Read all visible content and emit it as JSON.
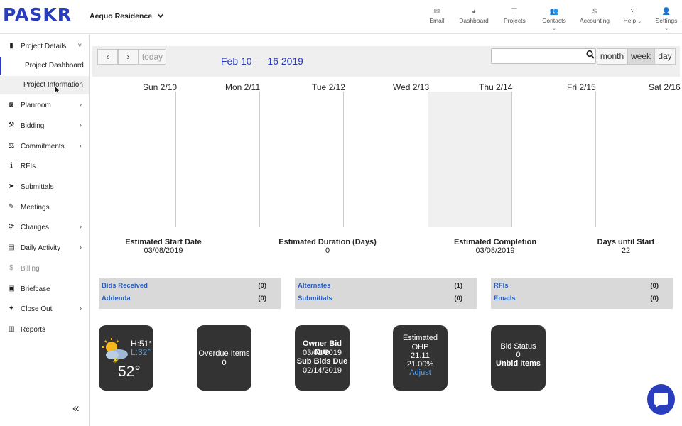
{
  "header": {
    "logo": "PASKR",
    "project": "Aequo Residence",
    "nav": [
      {
        "label": "Email",
        "icon": "envelope-icon",
        "glyph": "✉",
        "caret": ""
      },
      {
        "label": "Dashboard",
        "icon": "dashboard-icon",
        "glyph": "◕",
        "caret": ""
      },
      {
        "label": "Projects",
        "icon": "list-icon",
        "glyph": "☰",
        "caret": ""
      },
      {
        "label": "Contacts",
        "icon": "users-icon",
        "glyph": "👥",
        "caret": "⌄"
      },
      {
        "label": "Accounting",
        "icon": "dollar-icon",
        "glyph": "$",
        "caret": ""
      },
      {
        "label": "Help",
        "icon": "question-icon",
        "glyph": "?",
        "caret": "⌄"
      },
      {
        "label": "Settings",
        "icon": "user-icon",
        "glyph": "👤",
        "caret": "⌄"
      }
    ]
  },
  "sidebar": {
    "items": [
      {
        "label": "Project Details",
        "icon": "building-icon",
        "glyph": "▮",
        "chevron": "˅"
      },
      {
        "label": "Planroom",
        "icon": "camera-icon",
        "glyph": "◙",
        "chevron": "›"
      },
      {
        "label": "Bidding",
        "icon": "gavel-icon",
        "glyph": "⚒",
        "chevron": "›"
      },
      {
        "label": "Commitments",
        "icon": "scale-icon",
        "glyph": "⚖",
        "chevron": "›"
      },
      {
        "label": "RFIs",
        "icon": "info-icon",
        "glyph": "ℹ",
        "chevron": ""
      },
      {
        "label": "Submittals",
        "icon": "paper-plane-icon",
        "glyph": "➤",
        "chevron": ""
      },
      {
        "label": "Meetings",
        "icon": "edit-icon",
        "glyph": "✎",
        "chevron": ""
      },
      {
        "label": "Changes",
        "icon": "refresh-icon",
        "glyph": "⟳",
        "chevron": "›"
      },
      {
        "label": "Daily Activity",
        "icon": "book-icon",
        "glyph": "▤",
        "chevron": "›"
      },
      {
        "label": "Billing",
        "icon": "dollar-icon",
        "glyph": "$",
        "chevron": ""
      },
      {
        "label": "Briefcase",
        "icon": "briefcase-icon",
        "glyph": "▣",
        "chevron": ""
      },
      {
        "label": "Close Out",
        "icon": "pin-icon",
        "glyph": "✦",
        "chevron": "›"
      },
      {
        "label": "Reports",
        "icon": "chart-icon",
        "glyph": "▥",
        "chevron": ""
      }
    ],
    "subitems": [
      {
        "label": "Project Dashboard"
      },
      {
        "label": "Project Information"
      }
    ],
    "collapse": "«"
  },
  "calendar": {
    "today": "today",
    "range": "Feb 10 — 16 2019",
    "views": [
      "month",
      "week",
      "day"
    ],
    "days": [
      "Sun 2/10",
      "Mon 2/11",
      "Tue 2/12",
      "Wed 2/13",
      "Thu 2/14",
      "Fri 2/15",
      "Sat 2/16"
    ]
  },
  "stats": [
    {
      "label": "Estimated Start Date",
      "value": "03/08/2019"
    },
    {
      "label": "Estimated Duration (Days)",
      "value": "0"
    },
    {
      "label": "Estimated Completion",
      "value": "03/08/2019"
    },
    {
      "label": "Days until Start",
      "value": "22"
    }
  ],
  "panels": [
    {
      "rows": [
        {
          "label": "Bids Received",
          "count": "(0)"
        },
        {
          "label": "Addenda",
          "count": "(0)"
        }
      ]
    },
    {
      "rows": [
        {
          "label": "Alternates",
          "count": "(1)"
        },
        {
          "label": "Submittals",
          "count": "(0)"
        }
      ]
    },
    {
      "rows": [
        {
          "label": "RFIs",
          "count": "(0)"
        },
        {
          "label": "Emails",
          "count": "(0)"
        }
      ]
    }
  ],
  "tiles": {
    "weather": {
      "high": "H:51°",
      "low": "L:32°",
      "temp": "52°"
    },
    "overdue": {
      "label": "Overdue Items",
      "value": "0"
    },
    "bid": {
      "owner_label": "Owner Bid Due",
      "owner_date": "03/01/2019",
      "sub_label": "Sub Bids Due",
      "sub_date": "02/14/2019"
    },
    "ohp": {
      "label1": "Estimated",
      "label2": "OHP",
      "value": "21.11",
      "percent": "21.00%",
      "adjust": "Adjust"
    },
    "status": {
      "label": "Bid Status",
      "value": "0",
      "unbid": "Unbid Items"
    }
  },
  "colors": {
    "brand": "#2a3dbd",
    "link": "#2a5fbd",
    "tile": "#333333"
  }
}
